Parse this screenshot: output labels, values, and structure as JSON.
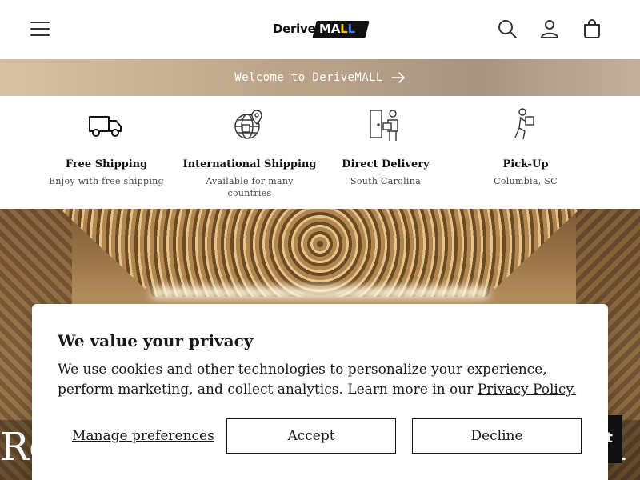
{
  "header": {
    "logo": {
      "derive": "Derive",
      "mall": [
        "M",
        "A",
        "L",
        "L"
      ]
    },
    "icons": {
      "menu": "menu-icon",
      "search": "search-icon",
      "account": "account-icon",
      "cart": "cart-icon"
    }
  },
  "announcement": {
    "text": "Welcome to DeriveMALL",
    "icon": "arrow-right-icon"
  },
  "features": [
    {
      "icon": "truck-icon",
      "title": "Free Shipping",
      "subtitle": "Enjoy with free shipping"
    },
    {
      "icon": "globe-shipping-icon",
      "title": "International Shipping",
      "subtitle": "Available for many countries"
    },
    {
      "icon": "delivery-person-icon",
      "title": "Direct Delivery",
      "subtitle": "South Carolina"
    },
    {
      "icon": "pickup-person-icon",
      "title": "Pick-Up",
      "subtitle": "Columbia, SC"
    }
  ],
  "hero": {
    "title_left_fragment": "Re",
    "title_right_fragment": "h",
    "chat_button_fragment": "t"
  },
  "privacy_modal": {
    "title": "We value your privacy",
    "body": "We use cookies and other technologies to personalize your experience, perform marketing, and collect analytics. Learn more in our",
    "policy_link": "Privacy Policy.",
    "manage_label": "Manage preferences",
    "accept_label": "Accept",
    "decline_label": "Decline"
  }
}
